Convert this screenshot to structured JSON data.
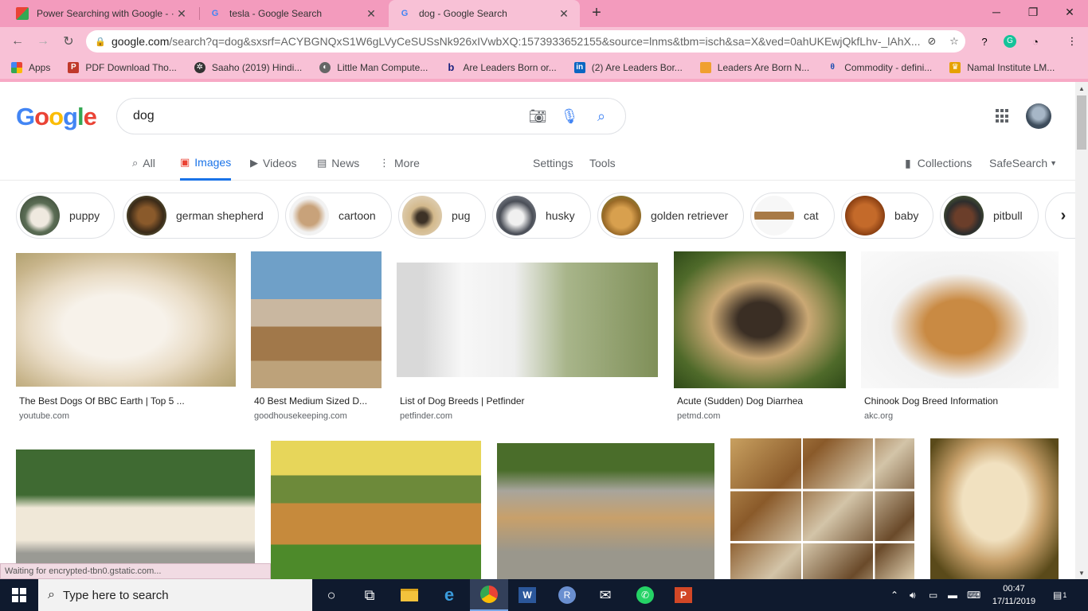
{
  "browser": {
    "tabs": [
      {
        "title": "Power Searching with Google - ·",
        "icon": "course-icon"
      },
      {
        "title": "tesla - Google Search",
        "icon": "google-g-icon"
      },
      {
        "title": "dog - Google Search",
        "icon": "google-g-icon",
        "active": true
      }
    ],
    "url_host": "google.com",
    "url_path": "/search?q=dog&sxsrf=ACYBGNQxS1W6gLVyCeSUSsNk926xIVwbXQ:1573933652155&source=lnms&tbm=isch&sa=X&ved=0ahUKEwjQkfLhv-_lAhX...",
    "bookmarks": [
      {
        "label": "Apps",
        "icon": "apps-grid-icon"
      },
      {
        "label": "PDF Download Tho...",
        "icon": "pdf-icon"
      },
      {
        "label": "Saaho (2019) Hindi...",
        "icon": "film-reel-icon"
      },
      {
        "label": "Little Man Compute...",
        "icon": "globe-icon"
      },
      {
        "label": "Are Leaders Born or...",
        "icon": "b-icon"
      },
      {
        "label": "(2) Are Leaders Bor...",
        "icon": "linkedin-icon"
      },
      {
        "label": "Leaders Are Born N...",
        "icon": "bookmark-folder-icon"
      },
      {
        "label": "Commodity - defini...",
        "icon": "dictionary-icon"
      },
      {
        "label": "Namal Institute LM...",
        "icon": "namal-icon"
      }
    ]
  },
  "google": {
    "query": "dog",
    "nav": [
      "All",
      "Images",
      "Videos",
      "News",
      "More"
    ],
    "tools": [
      "Settings",
      "Tools"
    ],
    "right": [
      "Collections",
      "SafeSearch"
    ],
    "chips": [
      "puppy",
      "german shepherd",
      "cartoon",
      "pug",
      "husky",
      "golden retriever",
      "cat",
      "baby",
      "pitbull"
    ],
    "results": [
      {
        "title": "The Best Dogs Of BBC Earth | Top 5 ...",
        "source": "youtube.com"
      },
      {
        "title": "40 Best Medium Sized D...",
        "source": "goodhousekeeping.com"
      },
      {
        "title": "List of Dog Breeds | Petfinder",
        "source": "petfinder.com"
      },
      {
        "title": "Acute (Sudden) Dog Diarrhea",
        "source": "petmd.com"
      },
      {
        "title": "Chinook Dog Breed Information",
        "source": "akc.org"
      }
    ],
    "status": "Waiting for encrypted-tbn0.gstatic.com..."
  },
  "taskbar": {
    "search_placeholder": "Type here to search",
    "time": "00:47",
    "date": "17/11/2019",
    "notifications": "1"
  },
  "colors": {
    "theme_pink": "#f7a9c5",
    "google_blue": "#1a73e8",
    "taskbar": "#0f1a2e"
  }
}
